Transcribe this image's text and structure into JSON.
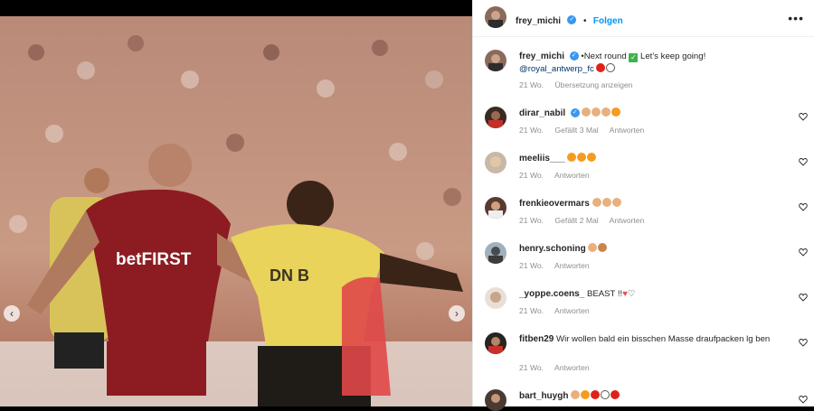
{
  "header": {
    "username": "frey_michi",
    "follow_label": "Folgen",
    "more_icon": "more-dots-icon"
  },
  "caption": {
    "username": "frey_michi",
    "text": "•Next round",
    "text2": "Let's keep going!",
    "mention": "@royal_antwerp_fc",
    "time": "21 Wo.",
    "translate_label": "Übersetzung anzeigen"
  },
  "comments": [
    {
      "username": "dirar_nabil",
      "verified": true,
      "time": "21 Wo.",
      "likes": "Gefällt 3 Mal",
      "reply": "Antworten"
    },
    {
      "username": "meeliis___",
      "time": "21 Wo.",
      "reply": "Antworten"
    },
    {
      "username": "frenkieovermars",
      "time": "21 Wo.",
      "likes": "Gefällt 2 Mal",
      "reply": "Antworten"
    },
    {
      "username": "henry.schoning",
      "time": "21 Wo.",
      "reply": "Antworten"
    },
    {
      "username": "_yoppe.coens_",
      "text": "BEAST !!",
      "time": "21 Wo.",
      "reply": "Antworten"
    },
    {
      "username": "fitben29",
      "text": "Wir wollen bald ein bisschen Masse draufpacken lg ben",
      "time": "21 Wo.",
      "reply": "Antworten"
    },
    {
      "username": "bart_huygh"
    }
  ],
  "photo": {
    "jersey_red_sponsor": "betFIRST",
    "jersey_yellow_sponsor": "DN B",
    "prev_icon": "chevron-left-icon",
    "next_icon": "chevron-right-icon"
  },
  "colors": {
    "accent": "#0095f6",
    "verified": "#3897f0",
    "red_kit": "#8c1c22",
    "yellow_kit": "#e9d35a"
  }
}
